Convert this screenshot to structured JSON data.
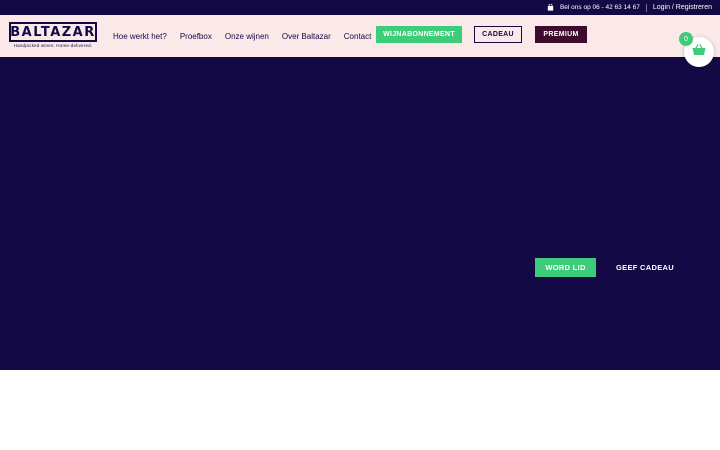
{
  "topbar": {
    "phone_text": "Bel ons op 06 - 42 63 14 67",
    "login_text": "Login / Registreren",
    "icon": "shopping-bag-icon"
  },
  "logo": {
    "name": "BALTAZAR",
    "tagline": "Handpicked wines. Home-delivered."
  },
  "nav": {
    "links": [
      "Hoe werkt het?",
      "Proefbox",
      "Onze wijnen",
      "Over Baltazar",
      "Contact"
    ],
    "wijnabonnement_label": "WIJNABONNEMENT",
    "cadeau_label": "CADEAU",
    "premium_label": "PREMIUM"
  },
  "cart": {
    "count": "0",
    "icon": "basket-icon"
  },
  "hero": {
    "primary_label": "WORD LID",
    "secondary_label": "GEEF CADEAU"
  },
  "colors": {
    "navy": "#130a45",
    "pink": "#fbe9ea",
    "green": "#3dcd7a",
    "burgundy": "#3d0b2c"
  }
}
